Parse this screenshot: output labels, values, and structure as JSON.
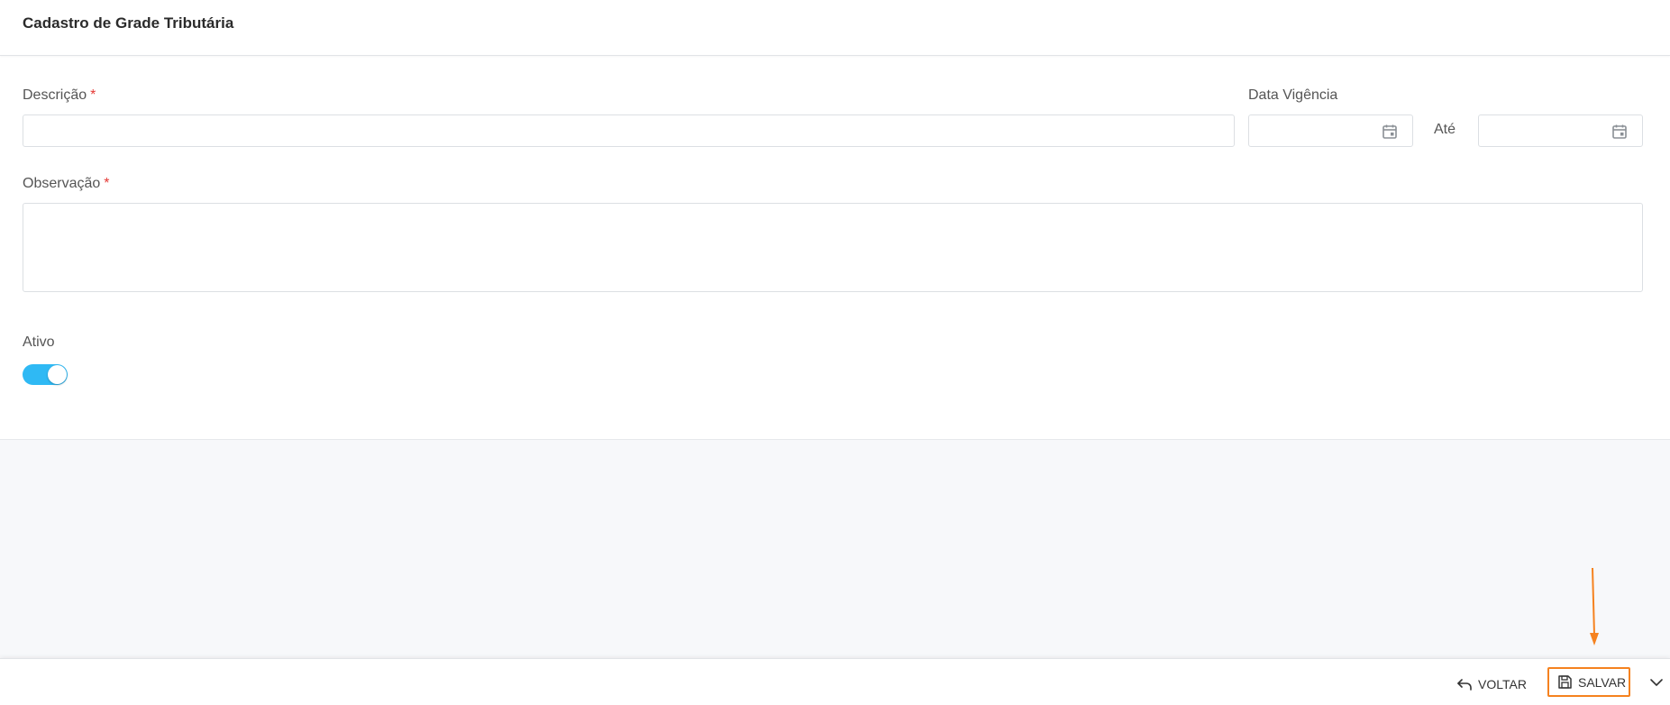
{
  "header": {
    "title": "Cadastro de Grade Tributária"
  },
  "form": {
    "descricao": {
      "label": "Descrição",
      "required_mark": "*",
      "value": ""
    },
    "data_vigencia": {
      "label": "Data Vigência",
      "from_value": "",
      "to_label": "Até",
      "to_value": "",
      "icon": "calendar-icon"
    },
    "observacao": {
      "label": "Observação",
      "required_mark": "*",
      "value": ""
    },
    "ativo": {
      "label": "Ativo",
      "checked": true
    }
  },
  "footer": {
    "voltar_label": "VOLTAR",
    "voltar_icon": "undo-arrow-icon",
    "salvar_label": "SALVAR",
    "salvar_icon": "save-icon",
    "more_icon": "chevron-down-icon"
  },
  "colors": {
    "toggle_on": "#2fb9f4",
    "required": "#e53935",
    "highlight": "#f5821f"
  }
}
